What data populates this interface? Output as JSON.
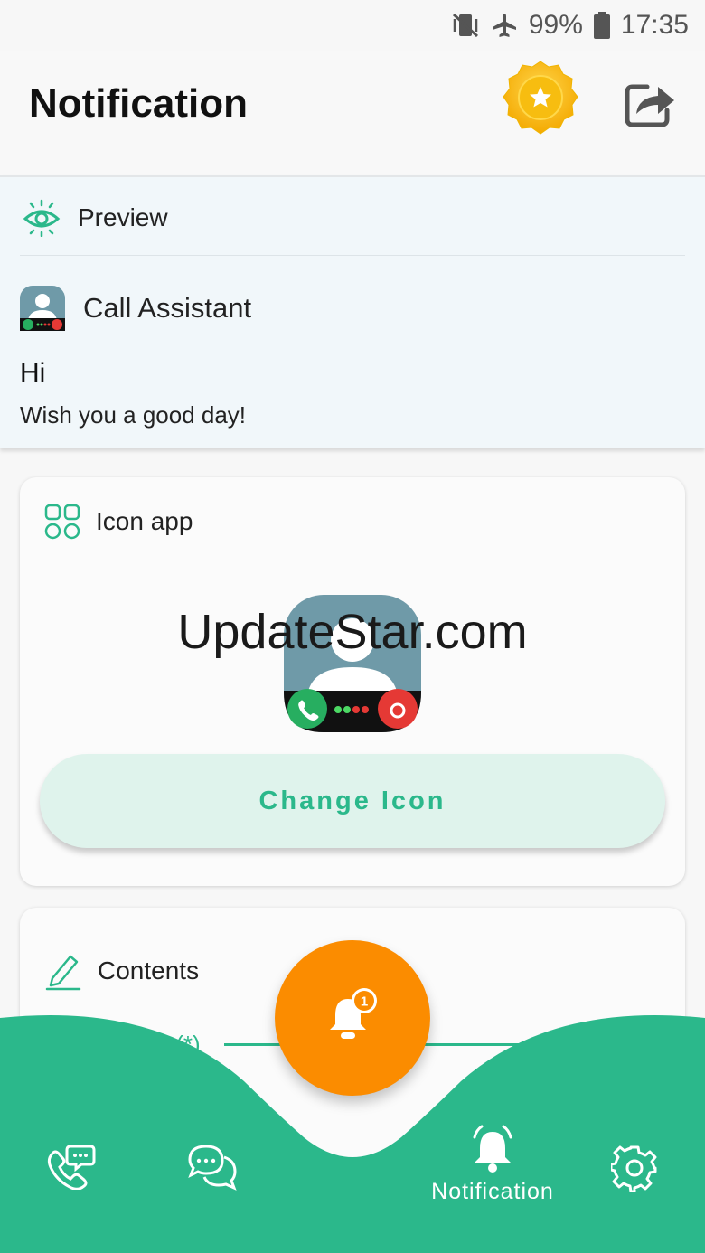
{
  "status_bar": {
    "battery": "99%",
    "time": "17:35",
    "icons": [
      "mute-vibrate-icon",
      "airplane-icon",
      "battery-icon"
    ]
  },
  "header": {
    "title": "Notification",
    "badge_icon": "premium-star-badge-icon",
    "share_icon": "share-icon"
  },
  "preview": {
    "label": "Preview",
    "app_name": "Call Assistant",
    "title": "Hi",
    "body": "Wish you a good day!"
  },
  "icon_app": {
    "label": "Icon app",
    "button": "Change Icon"
  },
  "watermark": "UpdateStar.com",
  "contents": {
    "label": "Contents",
    "field_label": "name (*)",
    "next_field_partial": "t"
  },
  "nav": {
    "items": [
      {
        "icon": "phone-chat-icon",
        "label": ""
      },
      {
        "icon": "chat-bubbles-icon",
        "label": ""
      },
      {
        "icon": "bell-icon",
        "label": "Notification",
        "active": true
      },
      {
        "icon": "gear-icon",
        "label": ""
      }
    ],
    "fab_icon": "bell-with-badge-icon",
    "fab_badge": "1"
  },
  "colors": {
    "accent": "#2bb88b",
    "fab": "#fb8c00",
    "badge": "#f5b800"
  }
}
